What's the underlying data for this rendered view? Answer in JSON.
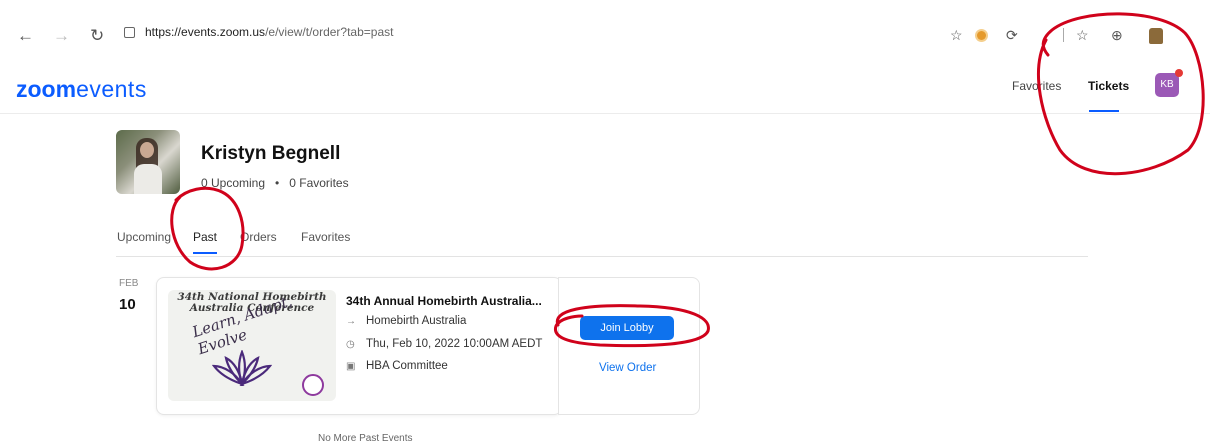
{
  "browser": {
    "url_host": "https://events.zoom.us",
    "url_path": "/e/view/t/order?tab=past"
  },
  "header": {
    "logo_bold": "zoom",
    "logo_light": "events",
    "links": [
      "Favorites",
      "Tickets"
    ],
    "active_link": "Tickets",
    "avatar_initials": "KB"
  },
  "profile": {
    "name": "Kristyn Begnell",
    "upcoming": "0 Upcoming",
    "separator": "•",
    "favorites": "0 Favorites"
  },
  "tabs": [
    "Upcoming",
    "Past",
    "Orders",
    "Favorites"
  ],
  "active_tab": "Past",
  "event": {
    "month": "FEB",
    "day": "10",
    "banner_title_line1": "34th National Homebirth",
    "banner_title_line2": "Australia Conference",
    "banner_script": "Learn, Adapt, Evolve",
    "title": "34th Annual Homebirth Australia...",
    "organizer": "Homebirth Australia",
    "datetime": "Thu, Feb 10, 2022 10:00AM AEDT",
    "host": "HBA Committee",
    "join_label": "Join Lobby",
    "view_order_label": "View Order"
  },
  "footer_text": "No More Past Events",
  "colors": {
    "brand": "#0b5cff",
    "button": "#0e72ed",
    "annotation": "#d0021b",
    "avatar": "#9b59b6"
  }
}
